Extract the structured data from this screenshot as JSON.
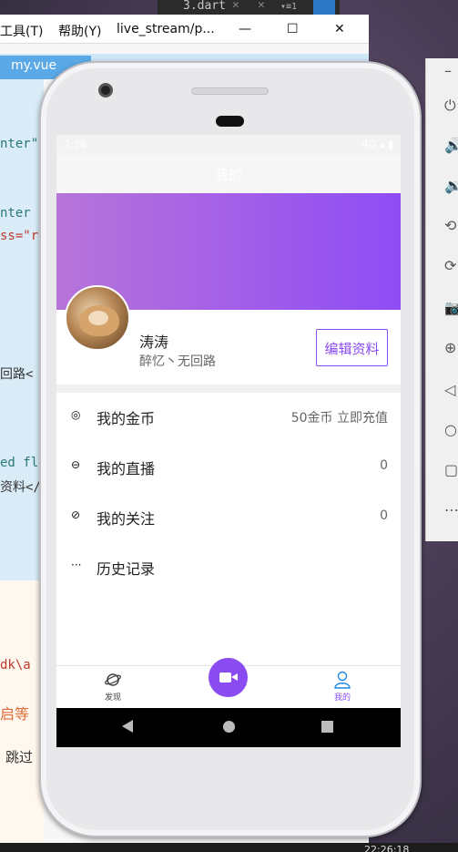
{
  "desktop": {
    "ide_tab": "3.dart",
    "menu": {
      "tools": "工具(T)",
      "help": "帮助(Y)",
      "project": "live_stream/p..."
    },
    "editor_tab": "my.vue",
    "code_snippets": [
      "nter\"",
      "nter",
      "ss=\"r",
      "回路<",
      "ed fl",
      "资料</",
      "dk\\a",
      "启等",
      "跳过"
    ],
    "clock": "22:26:18"
  },
  "phone": {
    "statusbar": {
      "time": "2:36",
      "icons": "4G ▴ ▮"
    },
    "nav_title": "我的",
    "profile": {
      "name": "涛涛",
      "signature": "醉忆丶无回路",
      "edit_button": "编辑资料"
    },
    "menu": [
      {
        "icon": "coin-icon",
        "label": "我的金币",
        "value": "50金币 立即充值"
      },
      {
        "icon": "live-icon",
        "label": "我的直播",
        "value": "0"
      },
      {
        "icon": "follow-icon",
        "label": "我的关注",
        "value": "0"
      },
      {
        "icon": "history-icon",
        "label": "历史记录",
        "value": ""
      }
    ],
    "tabbar": {
      "discover": "发现",
      "mine": "我的"
    },
    "colors": {
      "accent": "#8a4cf0",
      "banner_start": "#b774d9",
      "banner_end": "#8f4cf5"
    }
  }
}
